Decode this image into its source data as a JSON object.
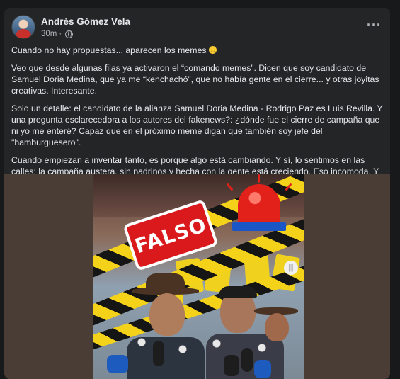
{
  "post": {
    "author": "Andrés Gómez Vela",
    "timestamp": "30m",
    "privacy_icon": "globe-icon",
    "more_label": "···",
    "paragraphs": [
      "Cuando no hay propuestas... aparecen los memes",
      "Veo que desde algunas filas ya activaron el “comando memes”. Dicen que soy candidato de Samuel Doria Medina, que ya me “kenchachó”, que no había gente en el cierre... y otras joyitas creativas. Interesante.",
      "Solo un detalle: el candidato de la alianza Samuel Doria Medina - Rodrigo Paz es Luis Revilla. Y una pregunta esclarecedora a los autores del fakenews?: ¿dónde fue el cierre de campaña que ni yo me enteré? Capaz que en el próximo meme digan que también soy jefe del \"hamburguesero\".",
      "Cuando empiezan a inventar tanto, es porque algo está cambiando. Y sí, lo sentimos en las calles: la campaña austera, sin padrinos y hecha con la gente está creciendo. Eso incomoda. Y cuando incomoda, aparecen los rumores, los memes y las historias de ficción."
    ]
  },
  "media": {
    "stamp_text": "FALSO",
    "audio_icon": "sound-wave-icon"
  },
  "colors": {
    "background": "#18191a",
    "card": "#242526",
    "text": "#e4e6eb",
    "muted": "#b0b3b8",
    "stamp_red": "#d9191c",
    "tape_yellow": "#f4d21a"
  }
}
